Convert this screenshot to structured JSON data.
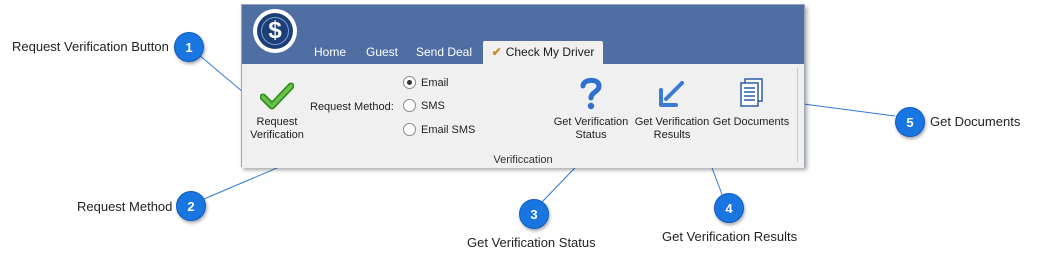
{
  "tabs": [
    {
      "label": "Home"
    },
    {
      "label": "Guest"
    },
    {
      "label": "Send Deal"
    },
    {
      "label": "Check My Driver",
      "active": true
    }
  ],
  "logo": {
    "glyph": "$"
  },
  "ribbon": {
    "request_verification": {
      "line1": "Request",
      "line2": "Verification",
      "icon": "green-check-icon"
    },
    "request_method_label": "Request Method:",
    "options": [
      {
        "label": "Email",
        "selected": true
      },
      {
        "label": "SMS",
        "selected": false
      },
      {
        "label": "Email SMS",
        "selected": false
      }
    ],
    "get_status": {
      "line1": "Get Verification",
      "line2": "Status",
      "icon": "question-mark-icon"
    },
    "get_results": {
      "line1": "Get Verification",
      "line2": "Results",
      "icon": "download-arrow-icon"
    },
    "get_documents": {
      "line1": "Get Documents",
      "icon": "documents-icon"
    },
    "group_label": "Verificcation"
  },
  "callouts": [
    {
      "number": "1",
      "text": "Request Verification Button"
    },
    {
      "number": "2",
      "text": "Request Method"
    },
    {
      "number": "3",
      "text": "Get Verification Status"
    },
    {
      "number": "4",
      "text": "Get Verification Results"
    },
    {
      "number": "5",
      "text": "Get Documents"
    }
  ],
  "colors": {
    "titlebar": "#4f6fa3",
    "callout": "#1976e0",
    "ribbon": "#f0f0f0"
  }
}
